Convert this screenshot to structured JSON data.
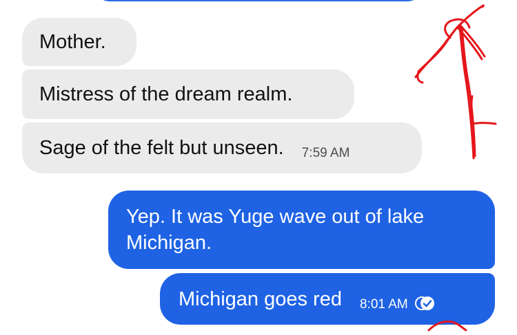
{
  "incoming": [
    {
      "text": "Mother."
    },
    {
      "text": "Mistress of the dream realm."
    },
    {
      "text": "Sage of the felt but unseen.",
      "time": "7:59 AM"
    }
  ],
  "outgoing": [
    {
      "text": "Yep. It was Yuge wave out of lake Michigan."
    },
    {
      "text": "Michigan goes red",
      "time": "8:01 AM"
    }
  ],
  "colors": {
    "incoming_bubble": "#ebebeb",
    "outgoing_bubble": "#1f63e4",
    "annotation": "#e4161b"
  },
  "icons": {
    "read_receipt": "double-check-read-icon",
    "annotation": "hand-drawn-red-arrow"
  }
}
